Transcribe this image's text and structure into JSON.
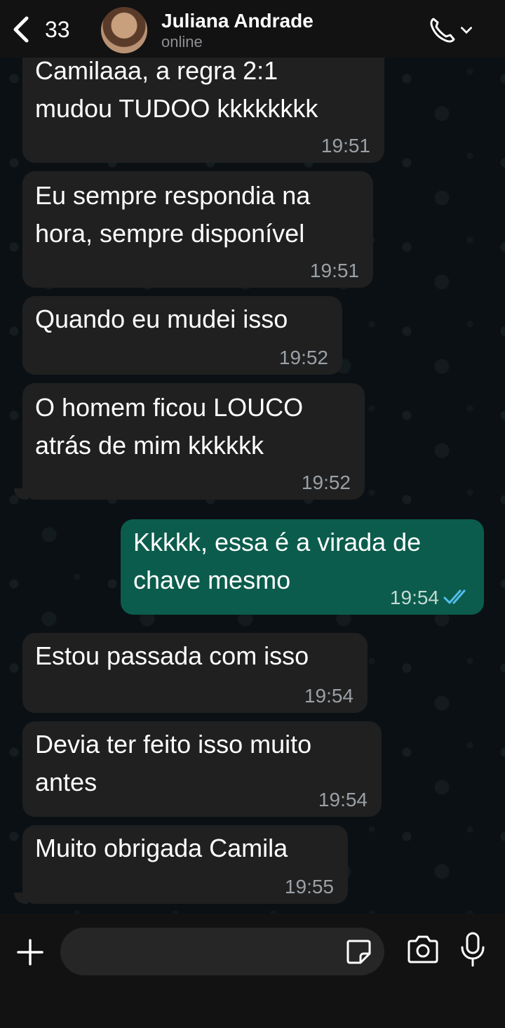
{
  "header": {
    "back_count": "33",
    "contact_name": "Juliana Andrade",
    "status": "online",
    "icons": {
      "back": "chevron-left-icon",
      "call": "phone-icon",
      "call_menu": "chevron-down-icon"
    }
  },
  "messages": [
    {
      "direction": "in",
      "text": "Camilaaa, a regra 2:1\nmudou TUDOO kkkkkkkk",
      "time": "19:51"
    },
    {
      "direction": "in",
      "text": "Eu sempre respondia na\nhora, sempre disponível",
      "time": "19:51"
    },
    {
      "direction": "in",
      "text": "Quando eu mudei isso",
      "time": "19:52"
    },
    {
      "direction": "in",
      "text": "O homem ficou LOUCO\natrás de mim kkkkkk",
      "time": "19:52"
    },
    {
      "direction": "out",
      "text": "Kkkkk, essa é a virada de\nchave mesmo",
      "time": "19:54",
      "status": "read"
    },
    {
      "direction": "in",
      "text": "Estou passada com isso",
      "time": "19:54"
    },
    {
      "direction": "in",
      "text": "Devia ter feito isso muito\nantes",
      "time": "19:54"
    },
    {
      "direction": "in",
      "text": "Muito obrigada Camila",
      "time": "19:55"
    }
  ],
  "composer": {
    "placeholder": "",
    "icons": {
      "add": "plus-icon",
      "sticker": "sticker-icon",
      "camera": "camera-icon",
      "mic": "microphone-icon"
    }
  },
  "colors": {
    "incoming_bubble": "#202020",
    "outgoing_bubble": "#0b5c4c",
    "read_ticks": "#53bdeb",
    "background": "#0b1014"
  }
}
